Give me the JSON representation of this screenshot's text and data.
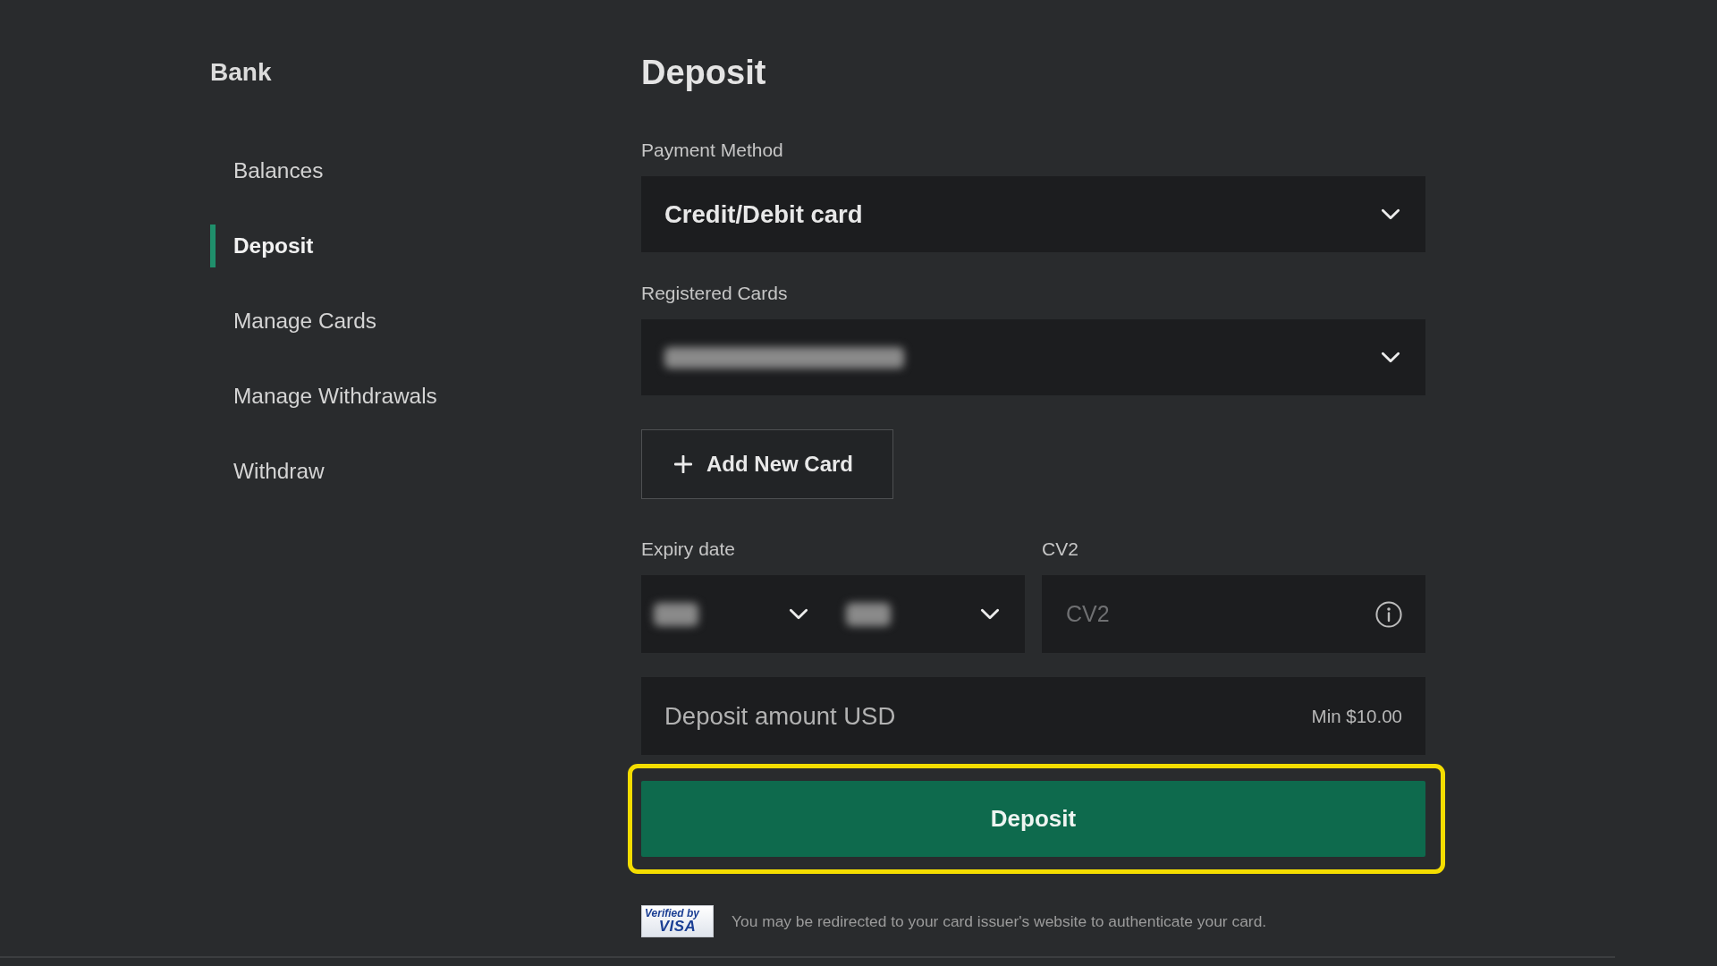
{
  "sidebar": {
    "title": "Bank",
    "items": [
      {
        "label": "Balances",
        "selected": false
      },
      {
        "label": "Deposit",
        "selected": true
      },
      {
        "label": "Manage Cards",
        "selected": false
      },
      {
        "label": "Manage Withdrawals",
        "selected": false
      },
      {
        "label": "Withdraw",
        "selected": false
      }
    ]
  },
  "form": {
    "title": "Deposit",
    "payment_method": {
      "label": "Payment Method",
      "value": "Credit/Debit card"
    },
    "registered_cards": {
      "label": "Registered Cards",
      "redacted": true
    },
    "add_card_button": {
      "label": "Add New Card"
    },
    "expiry": {
      "label": "Expiry date",
      "selects": [
        {
          "redacted": true
        },
        {
          "redacted": true
        }
      ]
    },
    "cv2": {
      "label": "CV2",
      "placeholder": "CV2"
    },
    "amount": {
      "placeholder": "Deposit amount USD",
      "hint": "Min $10.00"
    },
    "submit_button": {
      "label": "Deposit",
      "highlighted": true
    },
    "notice": {
      "logo": {
        "line_1": "Verified by",
        "line_2": "VISA"
      },
      "text": "You may be redirected to your card issuer's website to authenticate your card."
    }
  }
}
